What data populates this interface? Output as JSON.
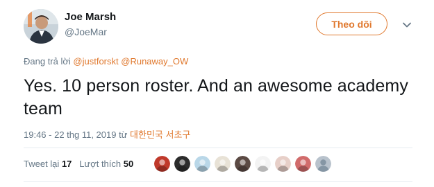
{
  "author": {
    "name": "Joe Marsh",
    "handle": "@JoeMar"
  },
  "follow_button": {
    "label": "Theo dõi"
  },
  "reply_to": {
    "prefix": "Đang trả lời",
    "mentions": [
      "@justforskt",
      "@Runaway_OW"
    ]
  },
  "tweet_text": "Yes. 10 person roster. And an awesome academy team",
  "meta": {
    "timestamp": "19:46 - 22 thg 11, 2019 từ",
    "location": "대한민국 서초구"
  },
  "stats": {
    "retweets_label": "Tweet lại",
    "retweets": "17",
    "likes_label": "Lượt thích",
    "likes": "50"
  },
  "likers": [
    {
      "name": "liker-1",
      "color": "#c0392b"
    },
    {
      "name": "liker-2",
      "color": "#2c2c2c"
    },
    {
      "name": "liker-3",
      "color": "#b9d7e8"
    },
    {
      "name": "liker-4",
      "color": "#e8e2d6"
    },
    {
      "name": "liker-5",
      "color": "#5b4a44"
    },
    {
      "name": "liker-6",
      "color": "#f3f3f3"
    },
    {
      "name": "liker-7",
      "color": "#e7cfc8"
    },
    {
      "name": "liker-8",
      "color": "#d16b6b"
    },
    {
      "name": "liker-9",
      "color": "#b8c2cc"
    }
  ],
  "colors": {
    "accent": "#e0782d",
    "text": "#14171a",
    "muted": "#657786",
    "divider": "#e6ecf0"
  }
}
